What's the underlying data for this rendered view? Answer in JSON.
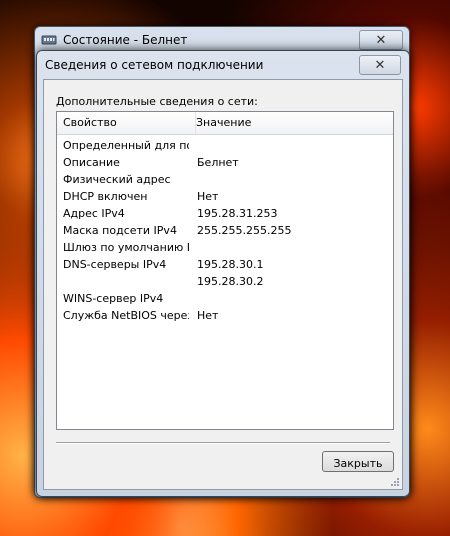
{
  "background_window": {
    "title": "Состояние - Белнет",
    "close_glyph": "✕",
    "icon": "network-icon"
  },
  "dialog": {
    "title": "Сведения о сетевом подключении",
    "close_glyph": "✕",
    "section_label": "Дополнительные сведения о сети:",
    "columns": {
      "property": "Свойство",
      "value": "Значение"
    },
    "rows": [
      {
        "property": "Определенный для по...",
        "value": ""
      },
      {
        "property": "Описание",
        "value": "Белнет"
      },
      {
        "property": "Физический адрес",
        "value": ""
      },
      {
        "property": "DHCP включен",
        "value": "Нет"
      },
      {
        "property": "Адрес IPv4",
        "value": "195.28.31.253"
      },
      {
        "property": "Маска подсети IPv4",
        "value": "255.255.255.255"
      },
      {
        "property": "Шлюз по умолчанию IP...",
        "value": ""
      },
      {
        "property": "DNS-серверы IPv4",
        "value": "195.28.30.1"
      },
      {
        "property": "",
        "value": "195.28.30.2"
      },
      {
        "property": "WINS-сервер IPv4",
        "value": ""
      },
      {
        "property": "Служба NetBIOS через...",
        "value": "Нет"
      }
    ],
    "close_button": "Закрыть"
  }
}
